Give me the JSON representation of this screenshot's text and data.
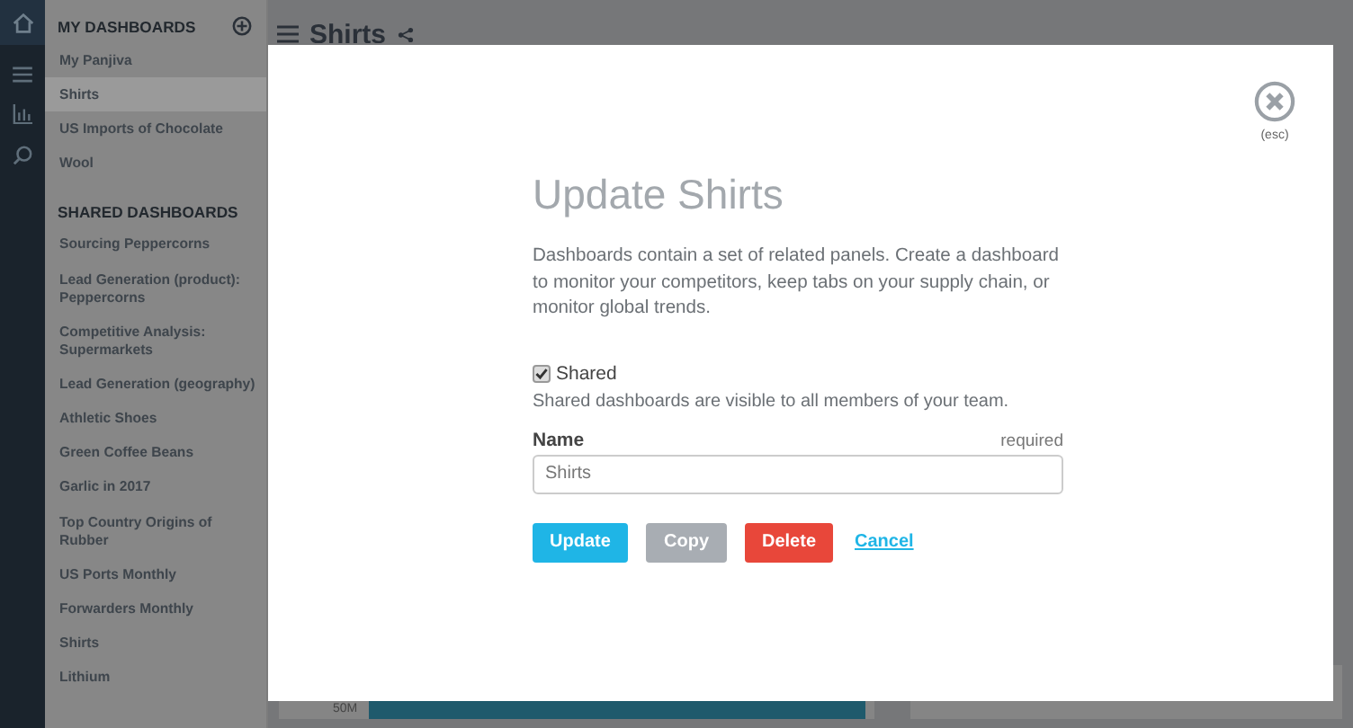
{
  "sidebar": {
    "my_title": "MY DASHBOARDS",
    "my_items": [
      {
        "label": "My Panjiva",
        "selected": false
      },
      {
        "label": "Shirts",
        "selected": true
      },
      {
        "label": "US Imports of Chocolate",
        "selected": false
      },
      {
        "label": "Wool",
        "selected": false
      }
    ],
    "shared_title": "SHARED DASHBOARDS",
    "shared_items": [
      {
        "label": "Sourcing Peppercorns",
        "selected": false
      },
      {
        "label": "Lead Generation (product): Peppercorns",
        "selected": false
      },
      {
        "label": "Competitive Analysis: Supermarkets",
        "selected": false
      },
      {
        "label": "Lead Generation (geography)",
        "selected": false
      },
      {
        "label": "Athletic Shoes",
        "selected": false
      },
      {
        "label": "Green Coffee Beans",
        "selected": false
      },
      {
        "label": "Garlic in 2017",
        "selected": false
      },
      {
        "label": "Top Country Origins of Rubber",
        "selected": false
      },
      {
        "label": "US Ports Monthly",
        "selected": false
      },
      {
        "label": "Forwarders Monthly",
        "selected": false
      },
      {
        "label": "Shirts",
        "selected": false
      },
      {
        "label": "Lithium",
        "selected": false
      }
    ]
  },
  "page": {
    "title": "Shirts",
    "axis_tick": "50M"
  },
  "modal": {
    "close_hint": "(esc)",
    "title": "Update Shirts",
    "description": "Dashboards contain a set of related panels. Create a dashboard to monitor your competitors, keep tabs on your supply chain, or monitor global trends.",
    "shared": {
      "label": "Shared",
      "checked": true,
      "help": "Shared dashboards are visible to all members of your team."
    },
    "name_field": {
      "label": "Name",
      "required": "required",
      "value": "Shirts"
    },
    "buttons": [
      {
        "label": "Update",
        "kind": "primary"
      },
      {
        "label": "Copy",
        "kind": "secondary"
      },
      {
        "label": "Delete",
        "kind": "danger"
      },
      {
        "label": "Cancel",
        "kind": "link"
      }
    ]
  }
}
